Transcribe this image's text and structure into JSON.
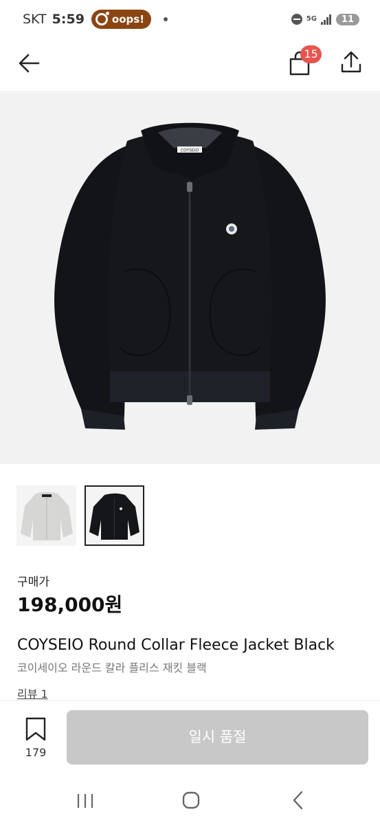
{
  "status_bar": {
    "carrier": "SKT",
    "time": "5:59",
    "notification_pill": "oops!",
    "network": "5G",
    "battery": "11"
  },
  "header": {
    "cart_count": "15",
    "icons": [
      "back-arrow-icon",
      "shopping-bag-icon",
      "share-icon"
    ]
  },
  "gallery": {
    "thumbnails": [
      {
        "color": "#d6d6d4",
        "selected": false
      },
      {
        "color": "#141619",
        "selected": true
      }
    ],
    "garment_label": "COYSEIO"
  },
  "product": {
    "price_label": "구매가",
    "price": "198,000원",
    "title": "COYSEIO Round Collar Fleece Jacket Black",
    "subtitle": "코이세이오 라운드 칼라 플리스 재킷 블랙",
    "review_link": "리뷰 1"
  },
  "action_bar": {
    "bookmark_count": "179",
    "soldout_label": "일시 품절"
  },
  "colors": {
    "badge": "#e8544f",
    "disabled_button": "#c8c8c8",
    "oops_pill": "#8b4513"
  }
}
